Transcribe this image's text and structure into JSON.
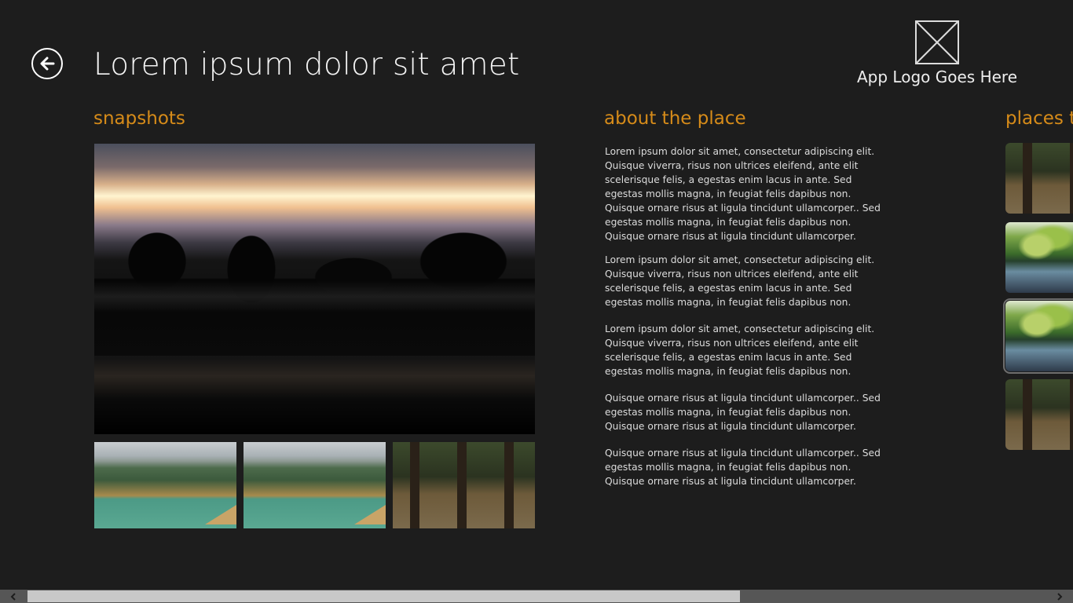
{
  "header": {
    "title": "Lorem ipsum dolor sit amet",
    "logo_text": "App Logo Goes Here"
  },
  "sections": {
    "snapshots": "snapshots",
    "about": "about the place",
    "places": "places to"
  },
  "about": {
    "paragraphs": [
      "Lorem ipsum dolor sit amet, consectetur adipiscing elit. Quisque viverra, risus non ultrices eleifend, ante elit scelerisque felis, a egestas enim lacus in ante. Sed egestas mollis magna, in feugiat felis dapibus non. Quisque ornare risus at ligula tincidunt ullamcorper.. Sed egestas mollis magna, in feugiat felis dapibus non. Quisque ornare risus at ligula tincidunt ullamcorper.",
      "Lorem ipsum dolor sit amet, consectetur adipiscing elit. Quisque viverra, risus non ultrices eleifend, ante elit scelerisque felis, a egestas enim lacus in ante. Sed egestas mollis magna, in feugiat felis dapibus non.",
      "Lorem ipsum dolor sit amet, consectetur adipiscing elit. Quisque viverra, risus non ultrices eleifend, ante elit scelerisque felis, a egestas enim lacus in ante. Sed egestas mollis magna, in feugiat felis dapibus non.",
      "Quisque ornare risus at ligula tincidunt ullamcorper.. Sed egestas mollis magna, in feugiat felis dapibus non. Quisque ornare risus at ligula tincidunt ullamcorper.",
      "Quisque ornare risus at ligula tincidunt ullamcorper.. Sed egestas mollis magna, in feugiat felis dapibus non. Quisque ornare risus at ligula tincidunt ullamcorper."
    ]
  },
  "icons": {
    "back": "back-arrow-icon",
    "logo": "image-placeholder-icon",
    "scroll_left": "chevron-left-icon",
    "scroll_right": "chevron-right-icon"
  },
  "colors": {
    "background": "#1d1d1d",
    "accent": "#d68b19",
    "text": "#ffffff"
  }
}
